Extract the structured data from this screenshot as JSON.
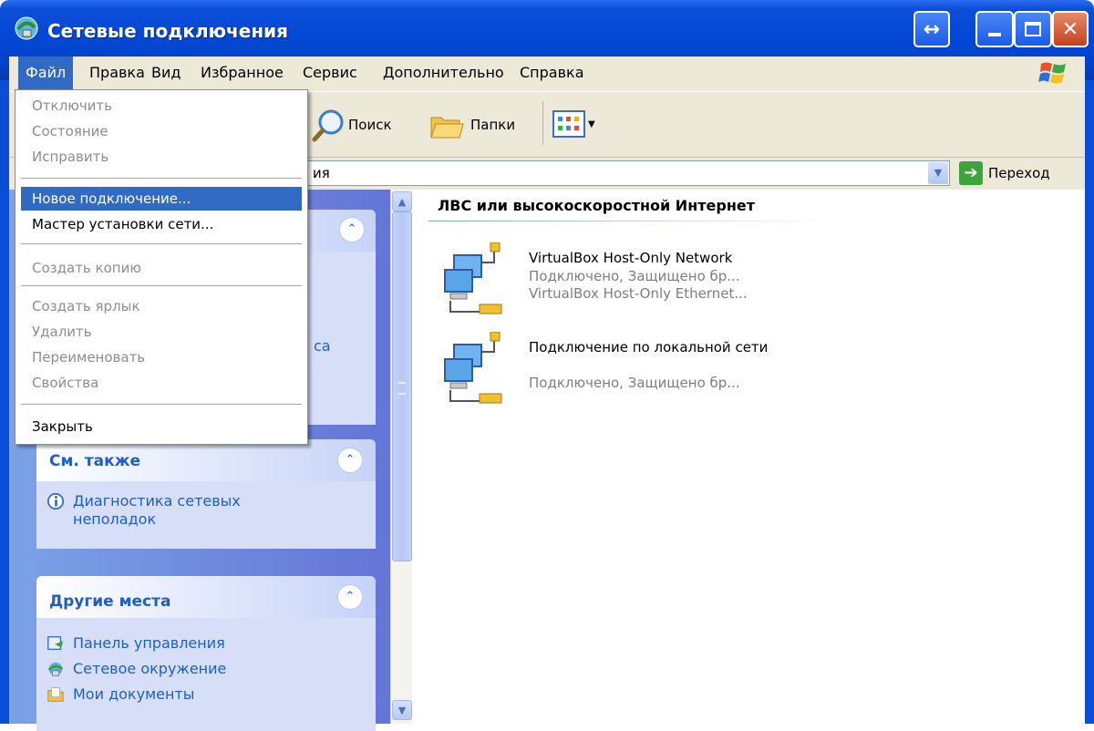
{
  "window": {
    "title": "Сетевые подключения"
  },
  "menubar": {
    "items": [
      "Файл",
      "Правка",
      "Вид",
      "Избранное",
      "Сервис",
      "Дополнительно",
      "Справка"
    ],
    "active": "Файл"
  },
  "toolbar": {
    "search_label": "Поиск",
    "folders_label": "Папки"
  },
  "addressbar": {
    "value_fragment": "ия",
    "go_label": "Переход"
  },
  "file_menu": {
    "items": [
      {
        "label": "Отключить",
        "enabled": false
      },
      {
        "label": "Состояние",
        "enabled": false
      },
      {
        "label": "Исправить",
        "enabled": false
      },
      {
        "label": "Новое подключение...",
        "enabled": true,
        "highlighted": true
      },
      {
        "label": "Мастер установки сети...",
        "enabled": true
      },
      {
        "label": "Создать копию",
        "enabled": false
      },
      {
        "label": "Создать ярлык",
        "enabled": false
      },
      {
        "label": "Удалить",
        "enabled": false
      },
      {
        "label": "Переименовать",
        "enabled": false
      },
      {
        "label": "Свойства",
        "enabled": false
      },
      {
        "label": "Закрыть",
        "enabled": true
      }
    ]
  },
  "left_pane": {
    "hidden_fragment": "са",
    "see_also": {
      "title": "См. также",
      "links": [
        "Диагностика сетевых неполадок"
      ]
    },
    "other_places": {
      "title": "Другие места",
      "links": [
        "Панель управления",
        "Сетевое окружение",
        "Мои документы"
      ]
    }
  },
  "content": {
    "group_title": "ЛВС или высокоскоростной Интернет",
    "connections": [
      {
        "name": "VirtualBox Host-Only Network",
        "status": "Подключено, Защищено бр...",
        "device": "VirtualBox Host-Only Ethernet..."
      },
      {
        "name": "Подключение по локальной сети",
        "status": "Подключено, Защищено бр..."
      }
    ]
  },
  "colors": {
    "title_bar": "#0a4ed8",
    "menu_highlight": "#316ac5",
    "task_link": "#215dc6",
    "disabled_text": "#8d8d8d"
  }
}
